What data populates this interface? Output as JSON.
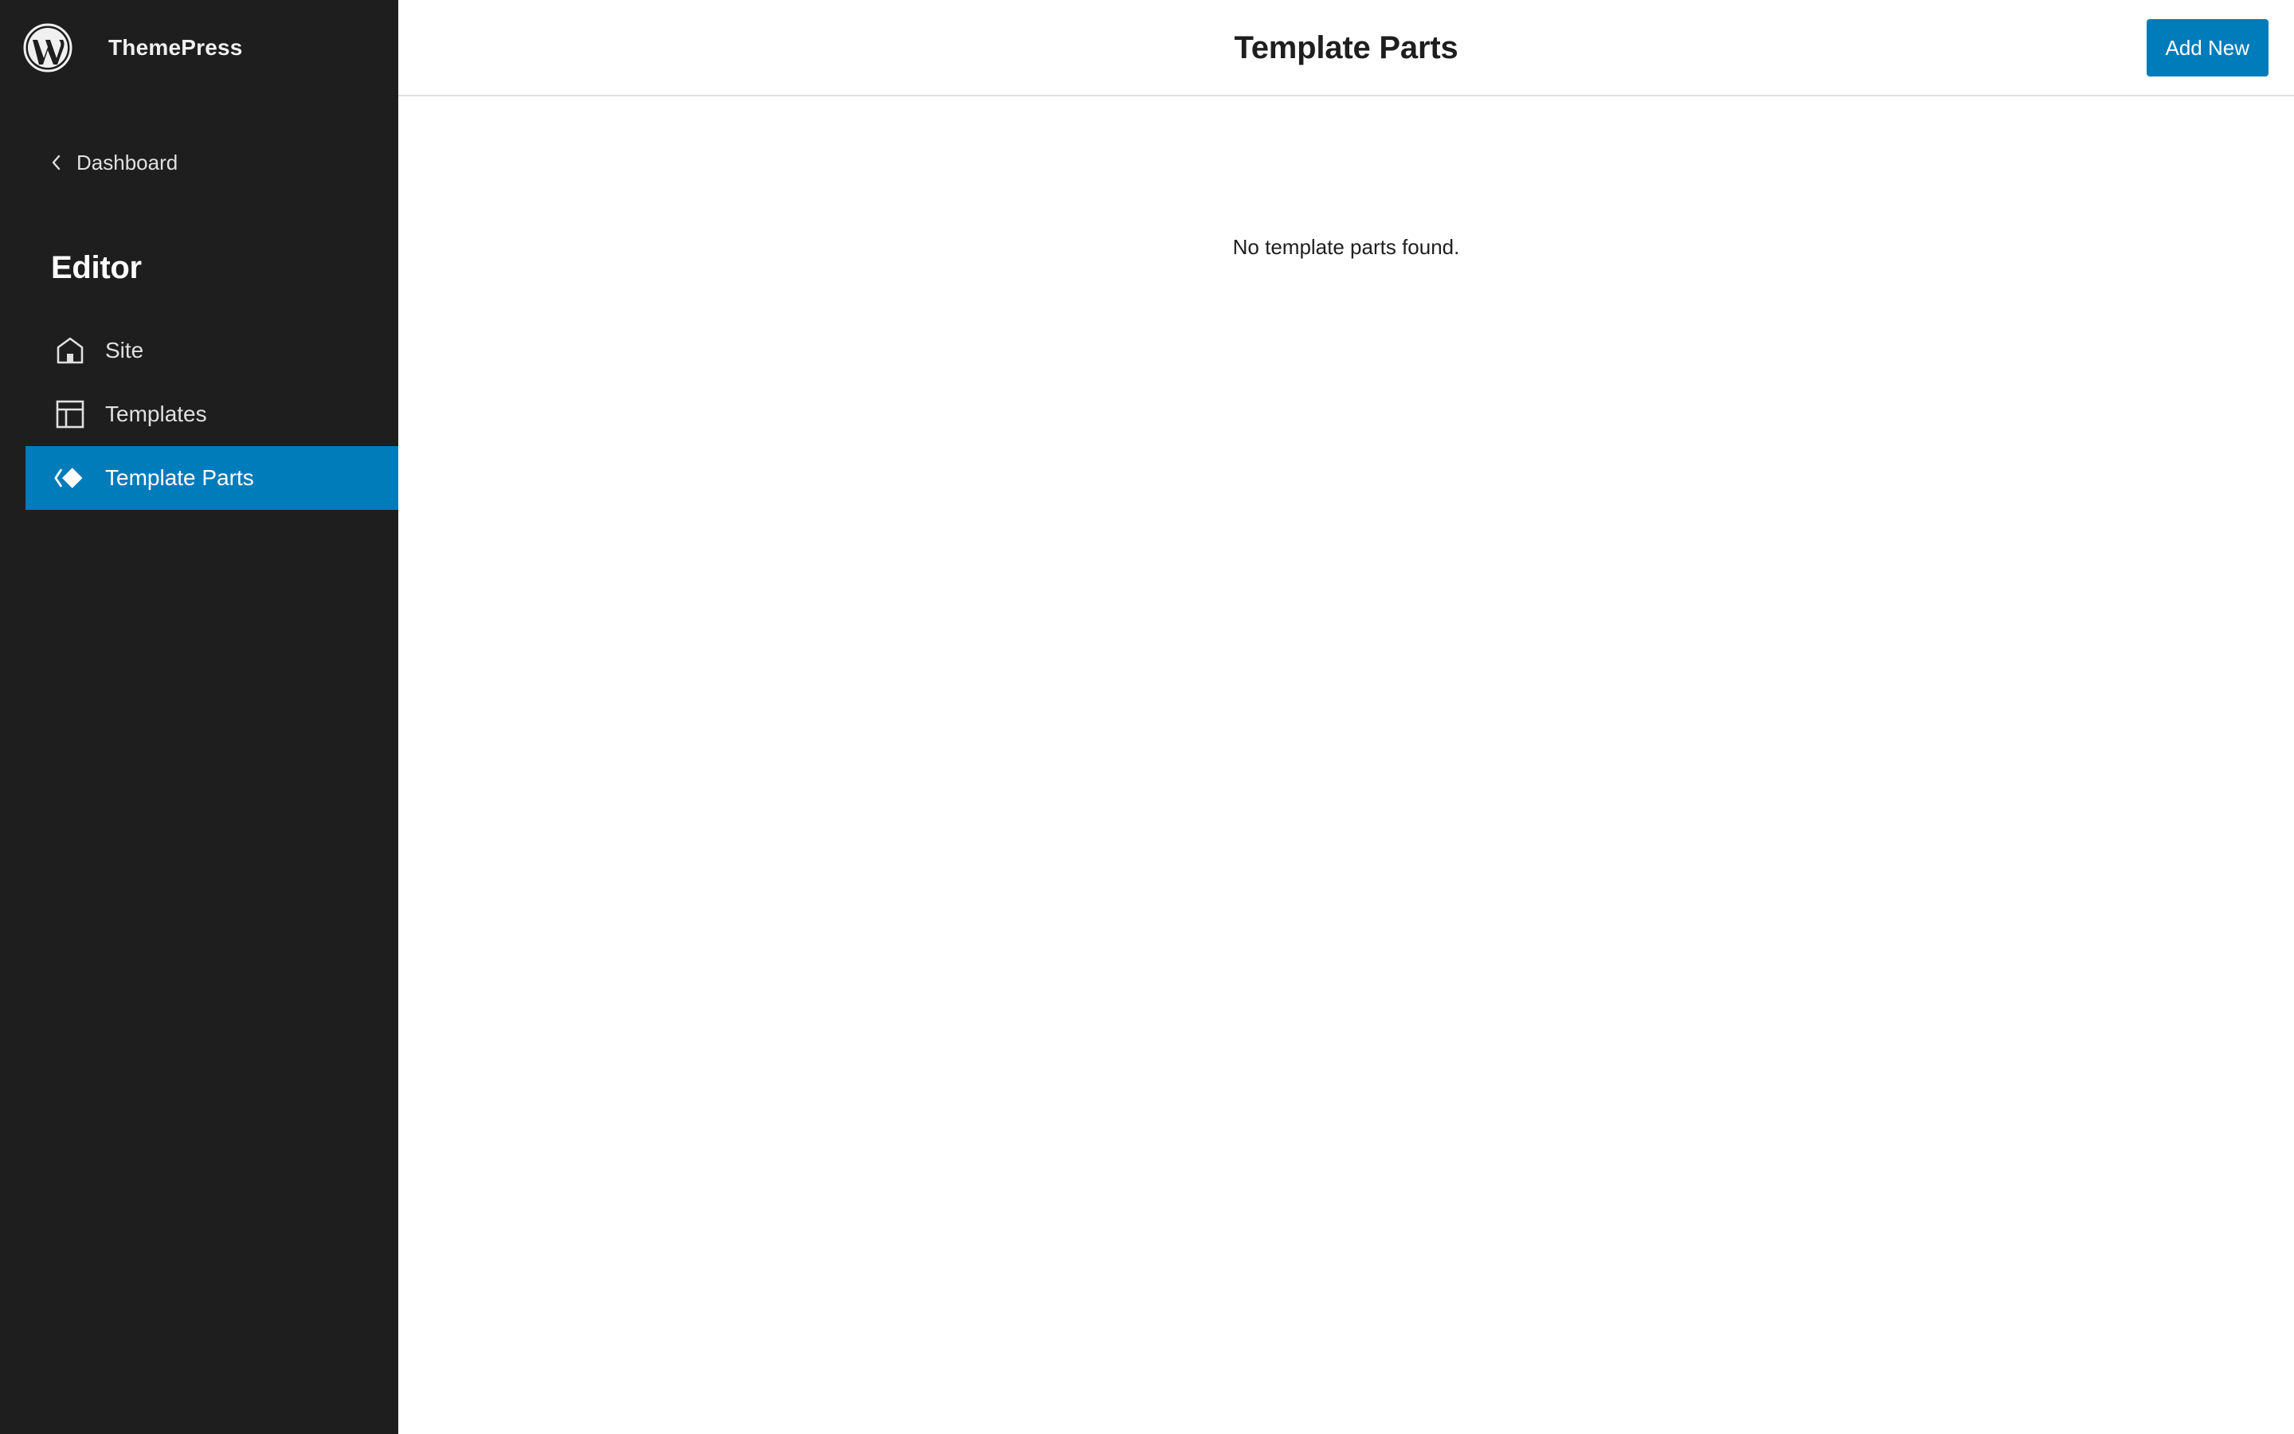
{
  "site_hub": {
    "logo_icon": "wordpress-logo-icon",
    "site_title": "ThemePress"
  },
  "sidebar": {
    "back_link": {
      "icon": "chevron-left-icon",
      "label": "Dashboard"
    },
    "section_title": "Editor",
    "items": [
      {
        "label": "Site",
        "icon": "home-icon",
        "active": false
      },
      {
        "label": "Templates",
        "icon": "layout-icon",
        "active": false
      },
      {
        "label": "Template Parts",
        "icon": "symbol-filled-icon",
        "active": true
      }
    ]
  },
  "header": {
    "title": "Template Parts",
    "add_new_label": "Add New"
  },
  "main": {
    "empty_message": "No template parts found."
  },
  "colors": {
    "sidebar_bg": "#1e1e1e",
    "accent": "#007cba",
    "text_dark": "#1e1e1e",
    "header_border": "#dddddd"
  }
}
